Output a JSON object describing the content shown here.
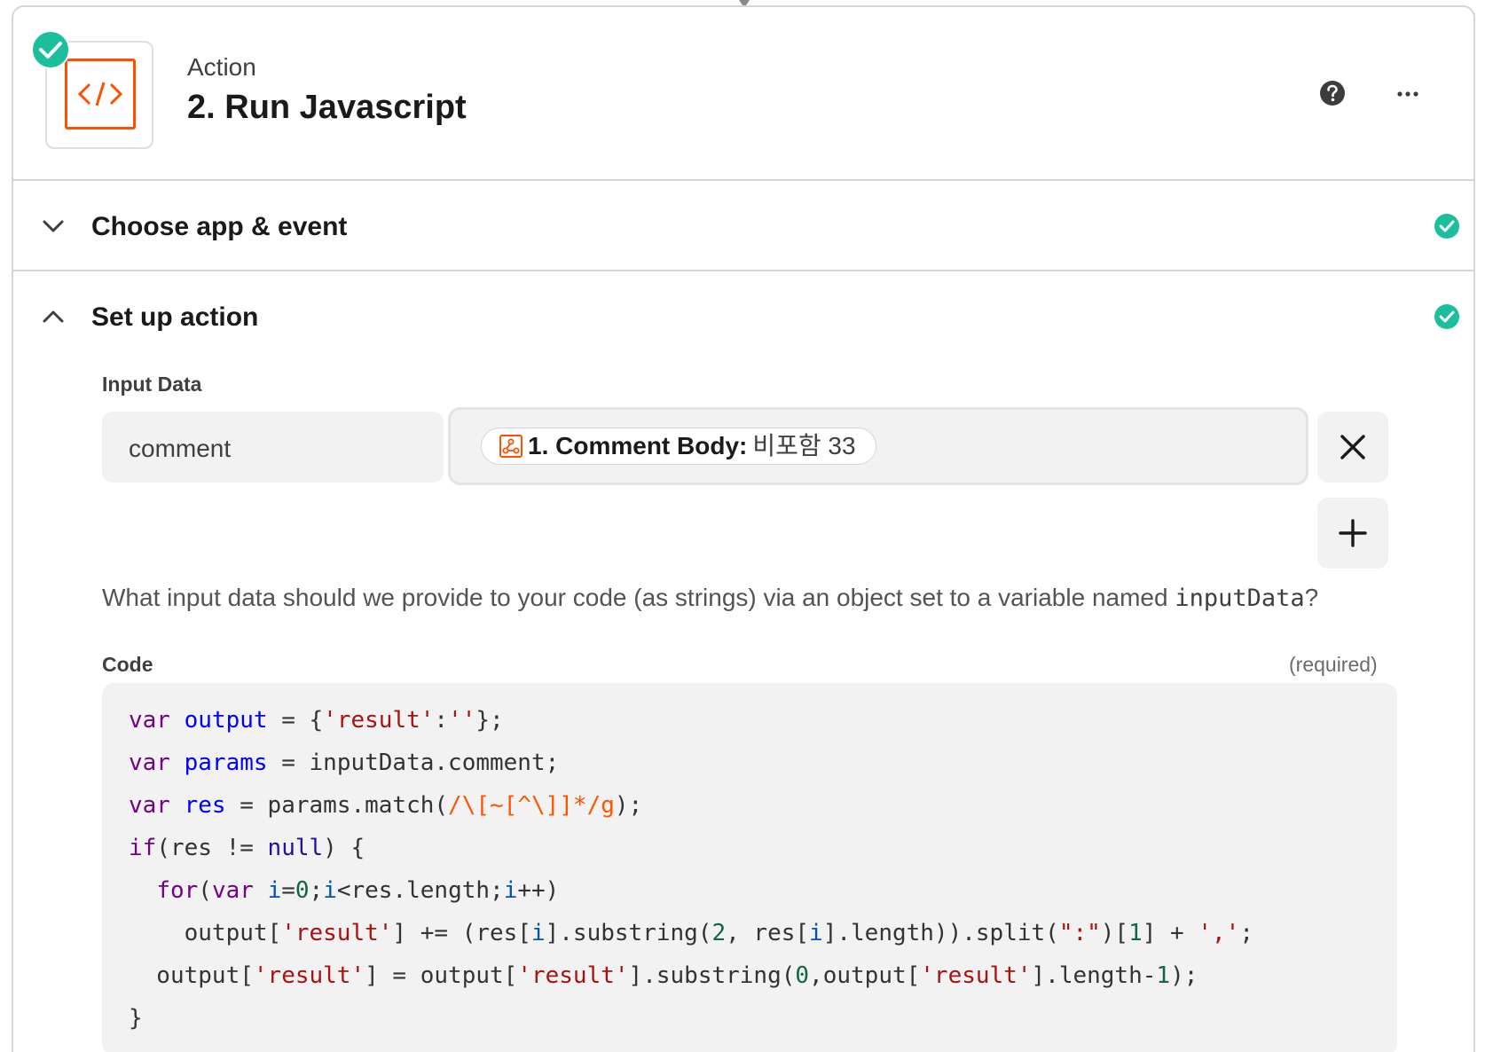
{
  "header": {
    "action_label": "Action",
    "step_title": "2. Run Javascript",
    "app_icon": "code-brackets-icon",
    "help_icon": "question-circle-icon",
    "more_icon": "ellipsis-icon"
  },
  "sections": [
    {
      "title": "Choose app & event",
      "expanded": false,
      "complete": true
    },
    {
      "title": "Set up action",
      "expanded": true,
      "complete": true
    }
  ],
  "input_data": {
    "label": "Input Data",
    "key": "comment",
    "value_pill": {
      "label": "1. Comment Body:",
      "value": "비포함 33",
      "icon": "webhook-icon"
    },
    "remove_icon": "close-icon",
    "add_icon": "plus-icon",
    "help_text_before": "What input data should we provide to your code (as strings) via an object set to a variable named ",
    "help_text_code": "inputData",
    "help_text_after": "?"
  },
  "code_field": {
    "label": "Code",
    "required_label": "(required)",
    "lines": [
      "var output = {'result':''};",
      "var params = inputData.comment;",
      "var res = params.match(/\\[~[^\\]]*/g);",
      "if(res != null) {",
      "  for(var i=0;i<res.length;i++)",
      "    output['result'] += (res[i].substring(2, res[i].length)).split(\":\")[1] + ',';",
      "  output['result'] = output['result'].substring(0,output['result'].length-1);",
      "}"
    ]
  },
  "colors": {
    "accent": "#ff4f00",
    "success": "#1bbf9c",
    "border": "#d5d5d5",
    "field_bg": "#f2f2f2"
  }
}
